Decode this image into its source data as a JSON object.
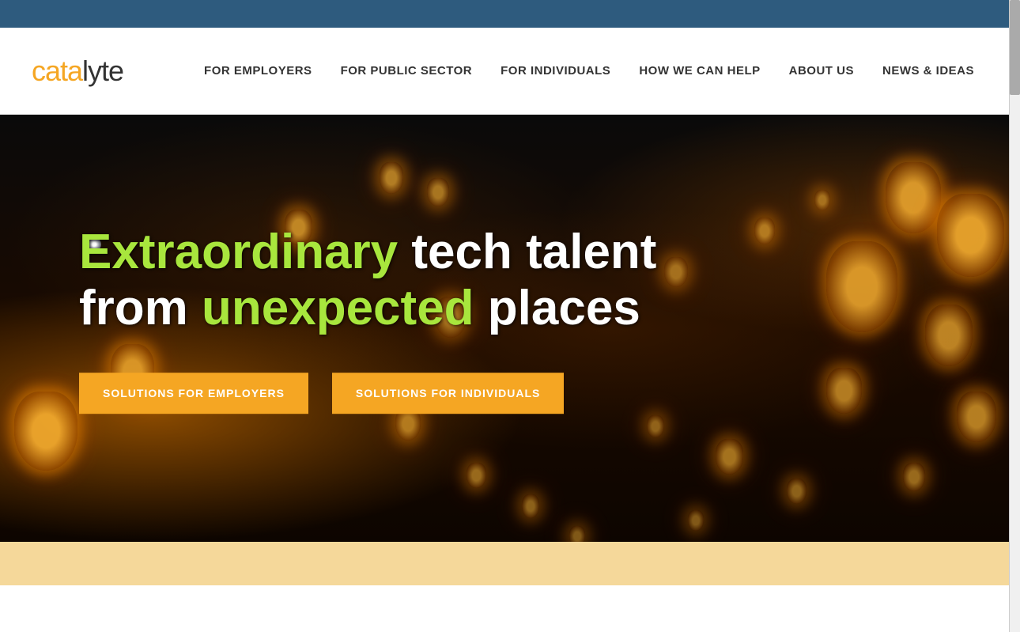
{
  "topbar": {
    "bg_color": "#2e5b7e"
  },
  "header": {
    "logo": {
      "part1": "cata",
      "part2": "lyte"
    },
    "nav": {
      "items": [
        {
          "label": "FOR EMPLOYERS",
          "id": "nav-for-employers"
        },
        {
          "label": "FOR PUBLIC SECTOR",
          "id": "nav-for-public-sector"
        },
        {
          "label": "FOR INDIVIDUALS",
          "id": "nav-for-individuals"
        },
        {
          "label": "HOW WE CAN HELP",
          "id": "nav-how-we-can-help"
        },
        {
          "label": "ABOUT US",
          "id": "nav-about-us"
        },
        {
          "label": "NEWS & IDEAS",
          "id": "nav-news-ideas"
        }
      ]
    }
  },
  "hero": {
    "headline_line1_part1": "Extraordinary",
    "headline_line1_part2": " tech talent",
    "headline_line2_part1": "from ",
    "headline_line2_part2": "unexpected",
    "headline_line2_part3": " places",
    "button1_label": "SOLUTIONS FOR EMPLOYERS",
    "button2_label": "SOLUTIONS FOR INDIVIDUALS"
  }
}
